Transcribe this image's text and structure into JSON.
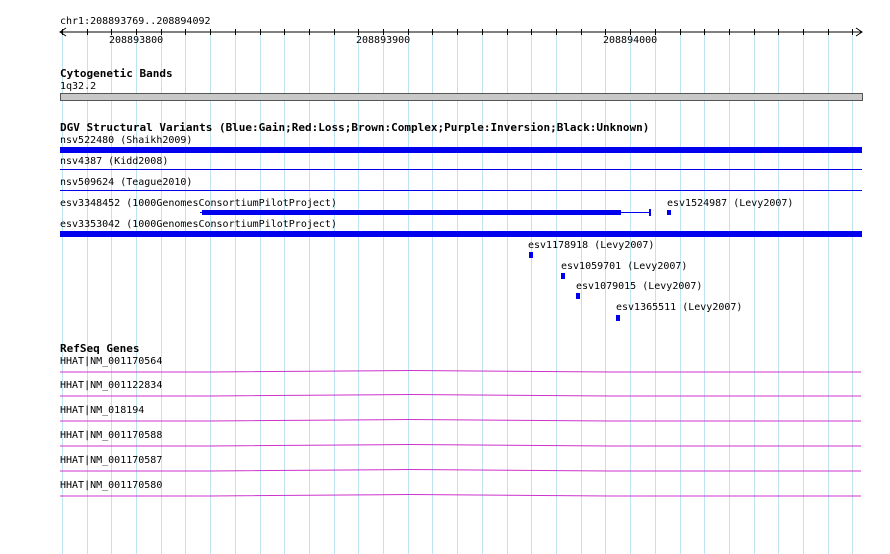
{
  "ruler": {
    "region": "chr1:208893769..208894092",
    "ticks": [
      "208893800",
      "208893900",
      "208894000"
    ]
  },
  "cytoband": {
    "title": "Cytogenetic Bands",
    "band": "1q32.2"
  },
  "dgv": {
    "title": "DGV Structural Variants (Blue:Gain;Red:Loss;Brown:Complex;Purple:Inversion;Black:Unknown)",
    "features": [
      "nsv522480 (Shaikh2009)",
      "nsv4387 (Kidd2008)",
      "nsv509624 (Teague2010)",
      "esv3348452 (1000GenomesConsortiumPilotProject)",
      "esv1524987 (Levy2007)",
      "esv3353042 (1000GenomesConsortiumPilotProject)",
      "esv1178918 (Levy2007)",
      "esv1059701 (Levy2007)",
      "esv1079015 (Levy2007)",
      "esv1365511 (Levy2007)"
    ]
  },
  "refseq": {
    "title": "RefSeq Genes",
    "genes": [
      "HHAT|NM_001170564",
      "HHAT|NM_001122834",
      "HHAT|NM_018194",
      "HHAT|NM_001170588",
      "HHAT|NM_001170587",
      "HHAT|NM_001170580"
    ]
  },
  "colors": {
    "gain": "#0000ee",
    "gene": "#cc33cc",
    "grid": "#bfe3ef",
    "band": "#c8c8c8"
  }
}
